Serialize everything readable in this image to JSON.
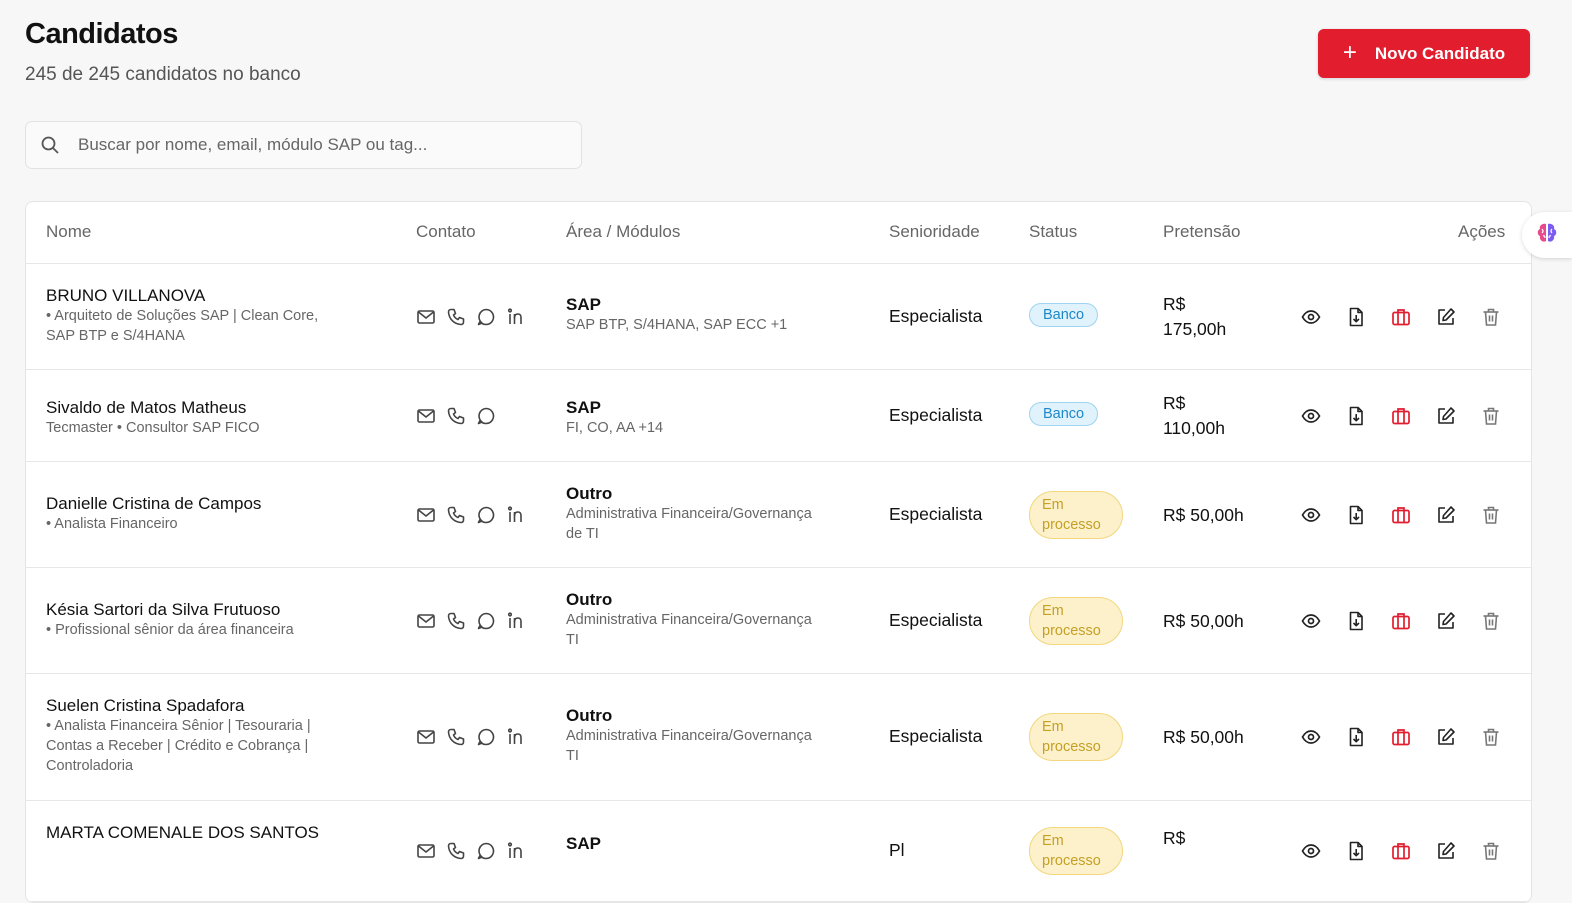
{
  "header": {
    "title": "Candidatos",
    "subtitle": "245 de 245 candidatos no banco",
    "new_button_label": "Novo Candidato"
  },
  "search": {
    "placeholder": "Buscar por nome, email, módulo SAP ou tag..."
  },
  "table": {
    "columns": [
      "Nome",
      "Contato",
      "Área / Módulos",
      "Senioridade",
      "Status",
      "Pretensão",
      "Ações"
    ],
    "rows": [
      {
        "name": "BRUNO VILLANOVA",
        "subtitle": [
          "• Arquiteto de Soluções SAP | Clean Core,",
          "SAP BTP e S/4HANA"
        ],
        "contact_icons": [
          "mail-icon",
          "phone-icon",
          "whatsapp-icon",
          "linkedin-icon"
        ],
        "area": "SAP",
        "modules": [
          "SAP BTP, S/4HANA, SAP ECC +1"
        ],
        "seniority": "Especialista",
        "status": "Banco",
        "status_type": "banco",
        "price": [
          "R$",
          "175,00h"
        ]
      },
      {
        "name": "Sivaldo de Matos Matheus",
        "subtitle": [
          "Tecmaster • Consultor SAP FICO"
        ],
        "contact_icons": [
          "mail-icon",
          "phone-icon",
          "whatsapp-icon"
        ],
        "area": "SAP",
        "modules": [
          "FI, CO, AA +14"
        ],
        "seniority": "Especialista",
        "status": "Banco",
        "status_type": "banco",
        "price": [
          "R$",
          "110,00h"
        ]
      },
      {
        "name": "Danielle Cristina de Campos",
        "subtitle": [
          "• Analista Financeiro"
        ],
        "contact_icons": [
          "mail-icon",
          "phone-icon",
          "whatsapp-icon",
          "linkedin-icon"
        ],
        "area": "Outro",
        "modules": [
          "Administrativa Financeira/Governança",
          "de TI"
        ],
        "seniority": "Especialista",
        "status": [
          "Em",
          "processo"
        ],
        "status_type": "proc",
        "price": [
          "R$ 50,00h"
        ]
      },
      {
        "name": "Késia Sartori da Silva Frutuoso",
        "subtitle": [
          "• Profissional sênior da área financeira"
        ],
        "contact_icons": [
          "mail-icon",
          "phone-icon",
          "whatsapp-icon",
          "linkedin-icon"
        ],
        "area": "Outro",
        "modules": [
          "Administrativa Financeira/Governança",
          "TI"
        ],
        "seniority": "Especialista",
        "status": [
          "Em",
          "processo"
        ],
        "status_type": "proc",
        "price": [
          "R$ 50,00h"
        ]
      },
      {
        "name": "Suelen Cristina Spadafora",
        "subtitle": [
          "• Analista Financeira Sênior | Tesouraria |",
          "Contas a Receber | Crédito e Cobrança |",
          "Controladoria"
        ],
        "contact_icons": [
          "mail-icon",
          "phone-icon",
          "whatsapp-icon",
          "linkedin-icon"
        ],
        "area": "Outro",
        "modules": [
          "Administrativa Financeira/Governança",
          "TI"
        ],
        "seniority": "Especialista",
        "status": [
          "Em",
          "processo"
        ],
        "status_type": "proc",
        "price": [
          "R$ 50,00h"
        ]
      },
      {
        "name": "MARTA COMENALE DOS SANTOS",
        "subtitle": [],
        "contact_icons": [
          "mail-icon",
          "phone-icon",
          "whatsapp-icon",
          "linkedin-icon"
        ],
        "area": "SAP",
        "modules": [],
        "seniority": "Pl",
        "status": [
          "Em",
          "processo"
        ],
        "status_type": "proc",
        "price": [
          "R$",
          ""
        ]
      }
    ]
  },
  "action_icons": [
    "view-icon",
    "download-cv-icon",
    "job-briefcase-icon",
    "edit-icon",
    "delete-icon"
  ],
  "colors": {
    "primary": "#e11d2e",
    "banco": "#1e88c7",
    "processo": "#c4a024"
  }
}
